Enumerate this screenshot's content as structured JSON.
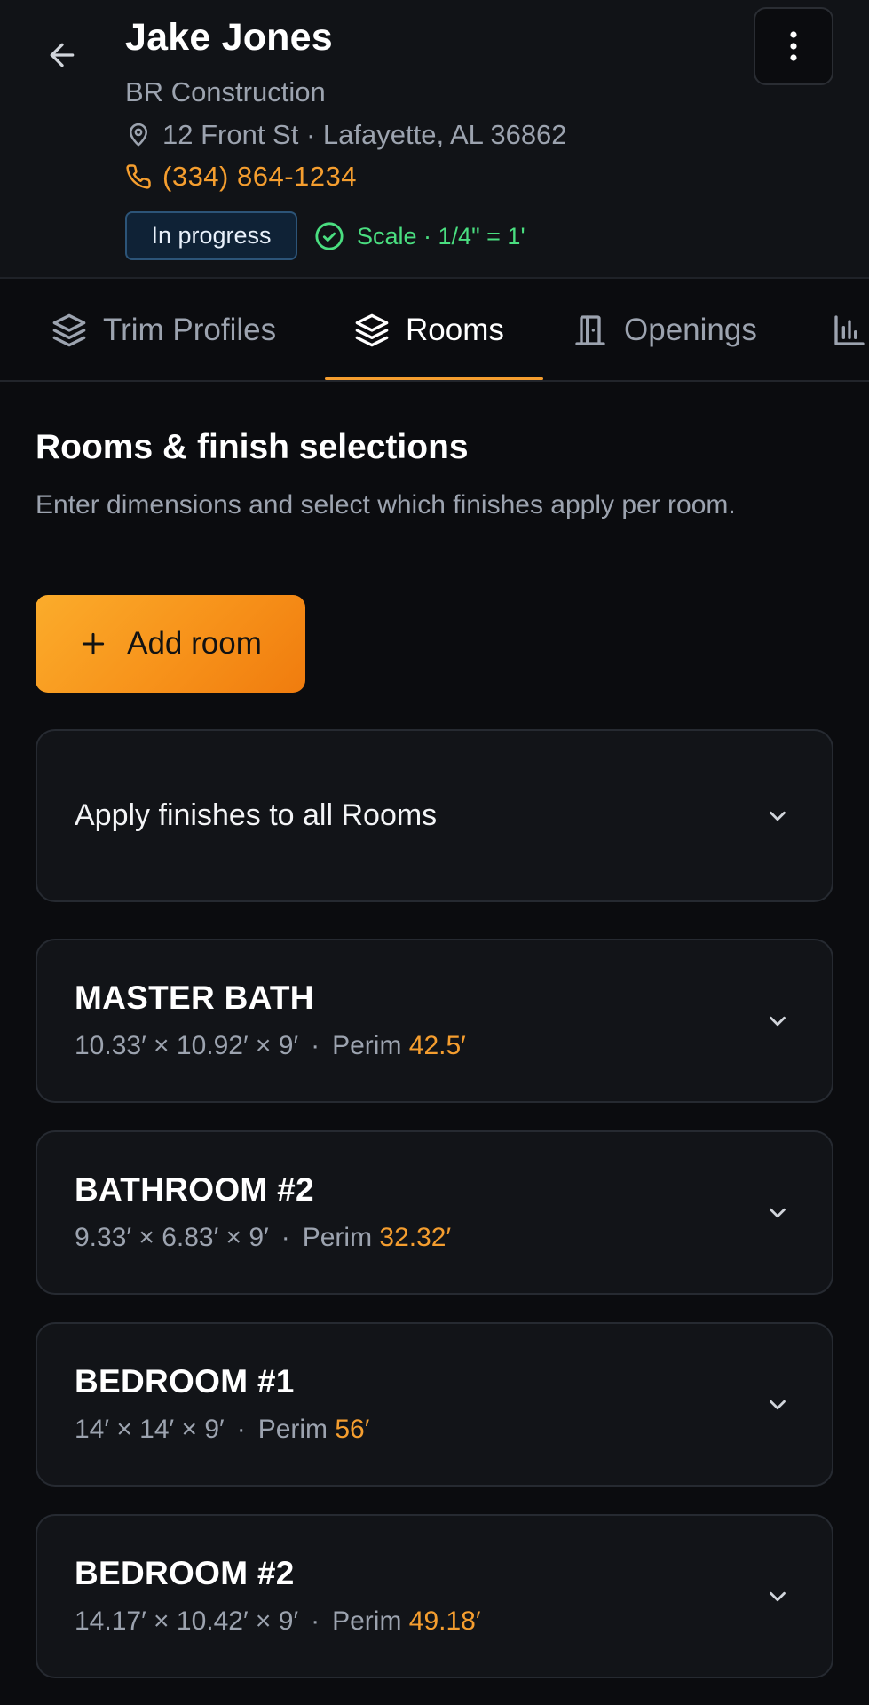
{
  "header": {
    "client_name": "Jake Jones",
    "company": "BR Construction",
    "address": "12 Front St · Lafayette, AL 36862",
    "phone": "(334) 864-1234",
    "status": "In progress",
    "scale": "Scale · 1/4\" = 1'"
  },
  "tabs": [
    {
      "label": "Trim Profiles",
      "icon": "layers-icon",
      "active": false
    },
    {
      "label": "Rooms",
      "icon": "layers-icon",
      "active": true
    },
    {
      "label": "Openings",
      "icon": "door-icon",
      "active": false
    },
    {
      "label": "",
      "icon": "bar-chart-icon",
      "active": false
    }
  ],
  "main": {
    "title": "Rooms & finish selections",
    "description": "Enter dimensions and select which finishes apply per room.",
    "add_room_label": "Add room",
    "apply_all_label": "Apply finishes to all Rooms",
    "perim_label": "Perim",
    "rooms": [
      {
        "name": "MASTER BATH",
        "dims": "10.33′ × 10.92′ × 9′",
        "perim": "42.5′"
      },
      {
        "name": "BATHROOM #2",
        "dims": "9.33′ × 6.83′ × 9′",
        "perim": "32.32′"
      },
      {
        "name": "BEDROOM #1",
        "dims": "14′ × 14′ × 9′",
        "perim": "56′"
      },
      {
        "name": "BEDROOM #2",
        "dims": "14.17′ × 10.42′ × 9′",
        "perim": "49.18′"
      }
    ]
  },
  "colors": {
    "accent": "#f59e2f",
    "success": "#4ade80",
    "background": "#0b0c0f",
    "card": "#121418"
  }
}
